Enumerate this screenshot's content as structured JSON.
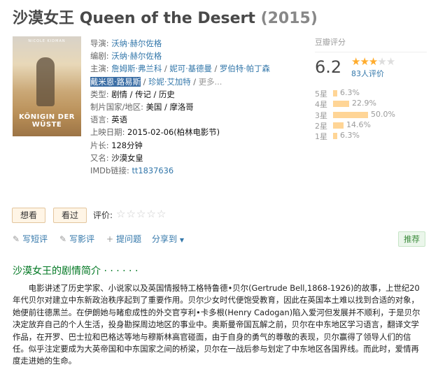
{
  "title": {
    "cn": "沙漠女王",
    "en": "Queen of the Desert",
    "year": "(2015)"
  },
  "poster": {
    "actor": "NICOLE KIDMAN",
    "title": "KÖNIGIN DER WÜSTE"
  },
  "info": {
    "director_label": "导演:",
    "director": "沃纳·赫尔佐格",
    "writer_label": "编剧:",
    "writer": "沃纳·赫尔佐格",
    "cast_label": "主演:",
    "cast": [
      "詹姆斯·弗兰科",
      "妮可·基德曼",
      "罗伯特·帕丁森",
      "戴米恩·路易斯",
      "珍妮·艾加特"
    ],
    "cast_sep": " / ",
    "more": "更多...",
    "genre_label": "类型:",
    "genre": [
      "剧情",
      "传记",
      "历史"
    ],
    "country_label": "制片国家/地区:",
    "country": "美国 / 摩洛哥",
    "language_label": "语言:",
    "language": "英语",
    "release_label": "上映日期:",
    "release": "2015-02-06(柏林电影节)",
    "runtime_label": "片长:",
    "runtime": "128分钟",
    "aka_label": "又名:",
    "aka": "沙漠女皇",
    "imdb_label": "IMDb链接:",
    "imdb": "tt1837636"
  },
  "rating": {
    "header": "豆瓣评分",
    "score": "6.2",
    "score_value": 6.2,
    "stars_filled": 3,
    "stars_total": 5,
    "people": "83人评价",
    "distribution": [
      {
        "label": "5星",
        "pct": "6.3%",
        "value": 6.3
      },
      {
        "label": "4星",
        "pct": "22.9%",
        "value": 22.9
      },
      {
        "label": "3星",
        "pct": "50.0%",
        "value": 50.0
      },
      {
        "label": "2星",
        "pct": "14.6%",
        "value": 14.6
      },
      {
        "label": "1星",
        "pct": "6.3%",
        "value": 6.3
      }
    ]
  },
  "actions": {
    "want": "想看",
    "seen": "看过",
    "rate_label": "评价:"
  },
  "tools": {
    "short_review": "写短评",
    "review": "写影评",
    "question": "提问题",
    "share": "分享到",
    "share_arrow": "▼",
    "recommend": "推荐"
  },
  "summary": {
    "heading": "沙漠女王的剧情简介 · · · · · ·",
    "text": "电影讲述了历史学家、小说家以及英国情报特工格特鲁德•贝尔(Gertrude Bell,1868-1926)的故事，上世纪20年代贝尔对建立中东新政治秩序起到了重要作用。贝尔少女时代便饱受教育，因此在英国本土难以找到合适的对象，她便前往德黑兰。在伊朗她与睹愈成性的外交官亨利•卡多根(Henry Cadogan)陷入爱河但发展并不顺利，于是贝尔决定放弃自己的个人生活，投身勘探周边地区的事业中。奥斯曼帝国瓦解之前，贝尔在中东地区学习语言，翻译文学作品，在开罗、巴士拉和巴格达等地与穆斯林高官碰面，由于自身的勇气的尊敬的表现，贝尔赢得了领导人们的信任。似乎注定要成为大英帝国和中东国家之间的桥梁，贝尔在一战后参与划定了中东地区各国界线。而此时，爱情再度走进她的生命。"
  },
  "colors": {
    "link": "#3377aa",
    "star": "#ffac2d",
    "bar": "#ffd596",
    "section": "#007722"
  }
}
